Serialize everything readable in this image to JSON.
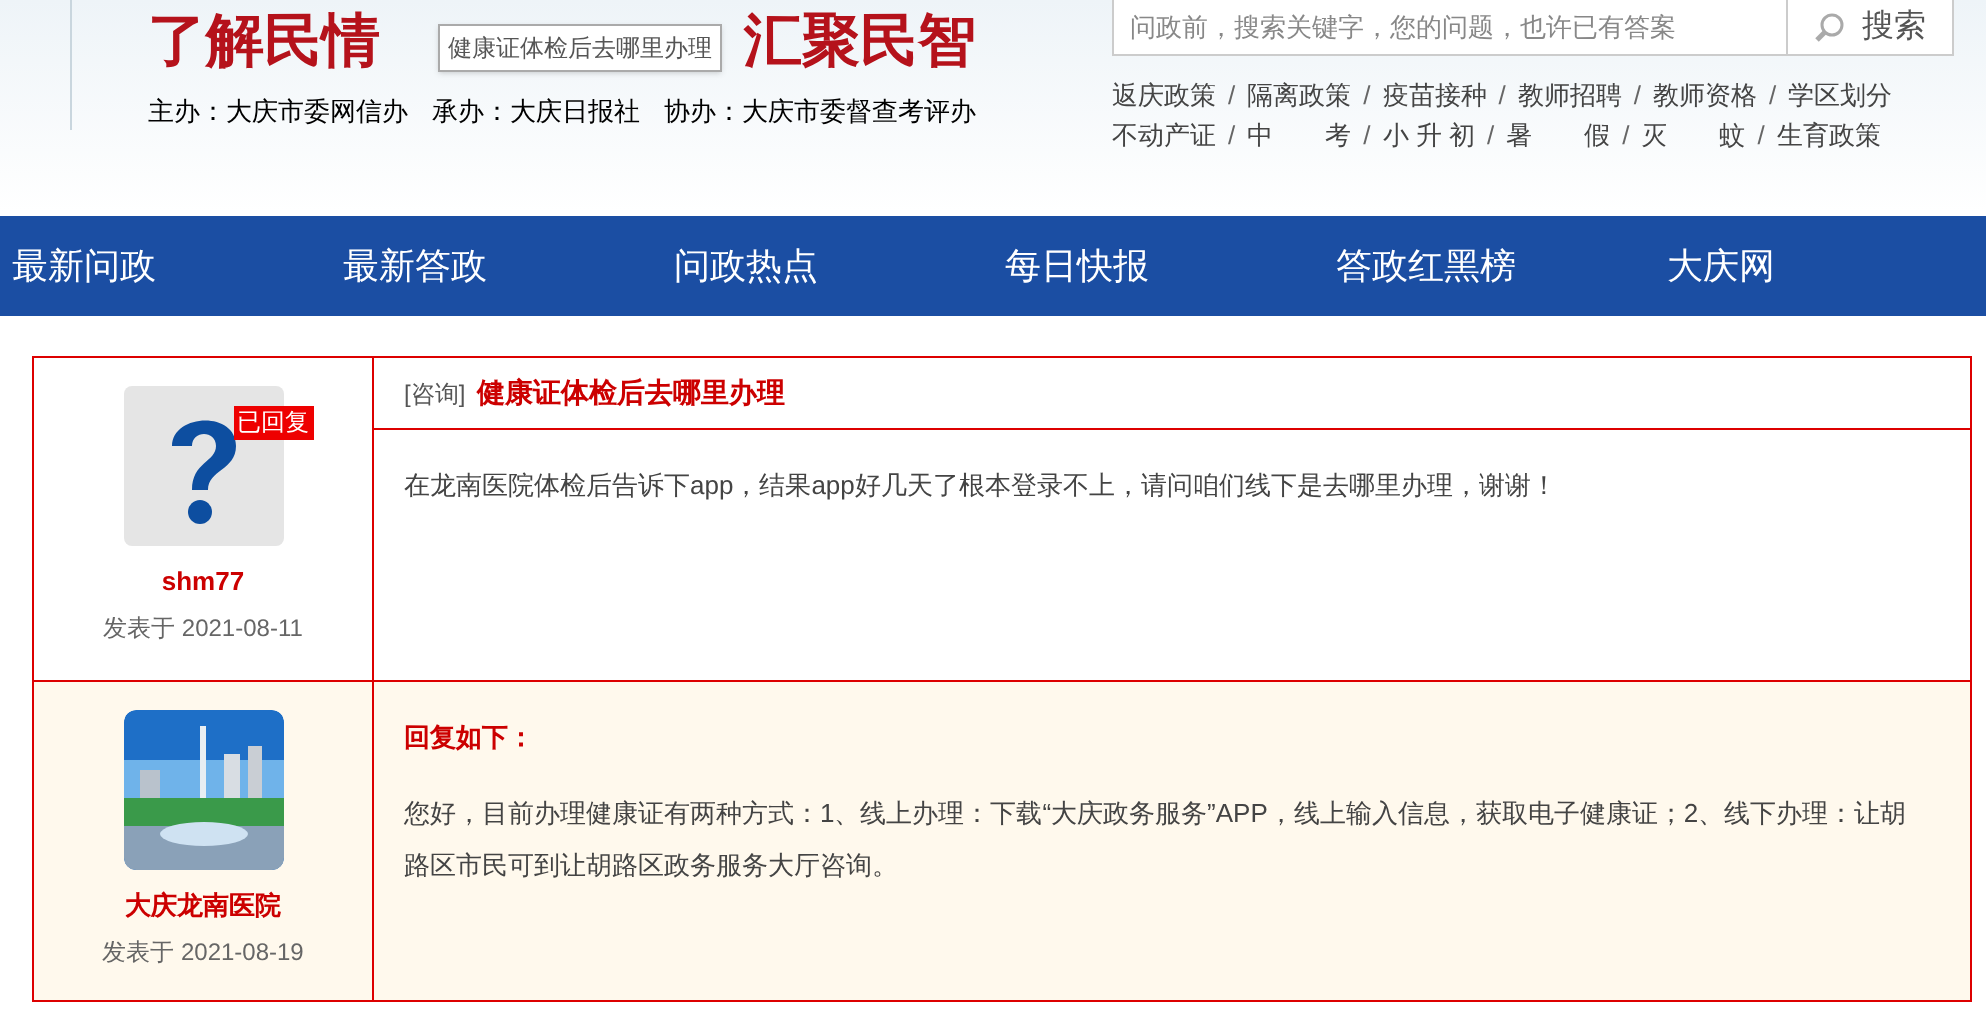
{
  "header": {
    "slogan_left": "了解民情",
    "slogan_right": "汇聚民智",
    "tooltip": "健康证体检后去哪里办理",
    "sponsors": [
      "主办：大庆市委网信办",
      "承办：大庆日报社",
      "协办：大庆市委督查考评办"
    ]
  },
  "search": {
    "placeholder": "问政前，搜索关键字，您的问题，也许已有答案",
    "button": "搜索"
  },
  "hot_tags": [
    [
      "返庆政策",
      "隔离政策",
      "疫苗接种",
      "教师招聘",
      "教师资格",
      "学区划分"
    ],
    [
      "不动产证",
      "中　　考",
      "小 升 初",
      "暑　　假",
      "灭　　蚊",
      "生育政策"
    ]
  ],
  "tag_separator": "/",
  "nav": [
    "最新问政",
    "最新答政",
    "问政热点",
    "每日快报",
    "答政红黑榜",
    "大庆网"
  ],
  "posts": [
    {
      "kind": "question",
      "author": "shm77",
      "date": "发表于 2021-08-11",
      "badge": "已回复",
      "category": "[咨询]",
      "title": "健康证体检后去哪里办理",
      "body": "在龙南医院体检后告诉下app，结果app好几天了根本登录不上，请问咱们线下是去哪里办理，谢谢！"
    },
    {
      "kind": "reply",
      "author": "大庆龙南医院",
      "date": "发表于 2021-08-19",
      "title": "回复如下：",
      "body": "您好，目前办理健康证有两种方式：1、线上办理：下载“大庆政务服务”APP，线上输入信息，获取电子健康证；2、线下办理：让胡路区市民可到让胡路区政务服务大厅咨询。"
    }
  ]
}
